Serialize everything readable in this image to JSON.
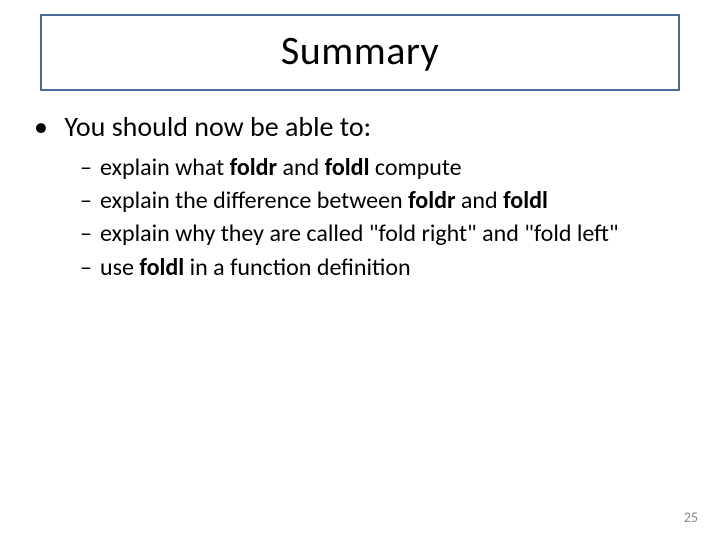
{
  "title": "Summary",
  "bullet_main": "You should now be able to:",
  "sub": {
    "a_pre": "explain what ",
    "a_b1": "foldr",
    "a_mid": " and ",
    "a_b2": "foldl",
    "a_post": " compute",
    "b_pre": "explain the difference between ",
    "b_b1": "foldr",
    "b_mid": " and ",
    "b_b2": "foldl",
    "c": "explain why they are called \"fold right\" and \"fold left\"",
    "d_pre": "use ",
    "d_b1": "foldl",
    "d_post": " in a function definition"
  },
  "page_number": "25"
}
